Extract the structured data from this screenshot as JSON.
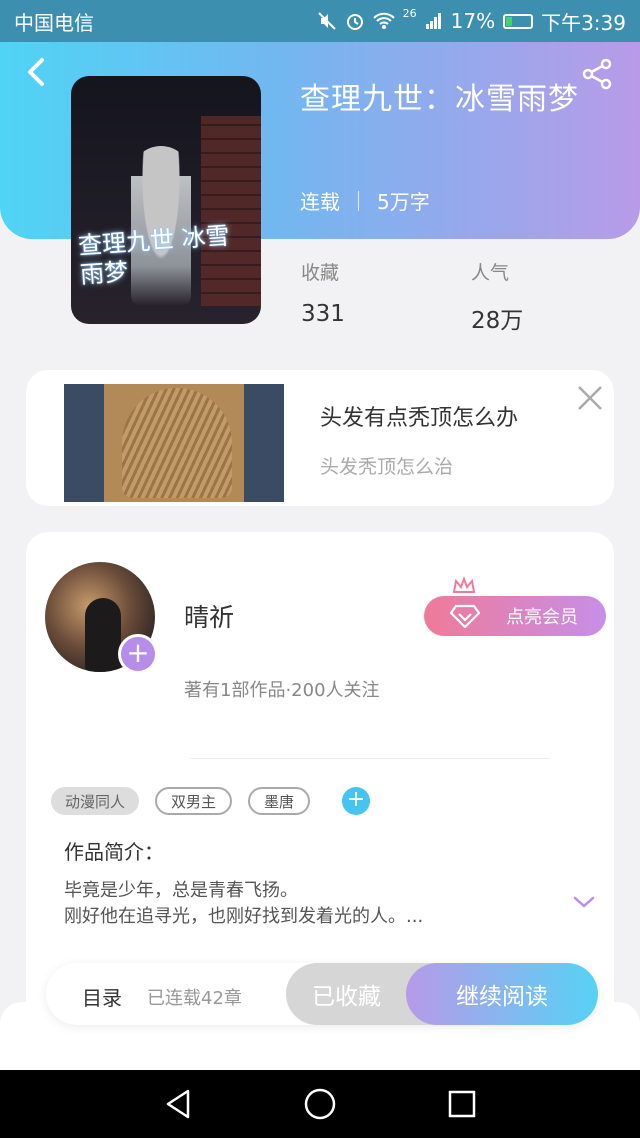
{
  "status_bar": {
    "carrier": "中国电信",
    "network": "26",
    "battery": "17%",
    "time": "下午3:39"
  },
  "book": {
    "title": "查理九世：冰雪雨梦",
    "status": "连载",
    "word_count": "5万字",
    "cover_title": "查理九世 冰雪雨梦",
    "favorites_label": "收藏",
    "favorites_value": "331",
    "popularity_label": "人气",
    "popularity_value": "28万"
  },
  "ad": {
    "title": "头发有点秃顶怎么办",
    "subtitle": "头发秃顶怎么治"
  },
  "author": {
    "name": "晴祈",
    "info": "著有1部作品·200人关注",
    "vip_label": "点亮会员"
  },
  "tags": [
    {
      "label": "动漫同人"
    },
    {
      "label": "双男主"
    },
    {
      "label": "墨唐"
    }
  ],
  "intro": {
    "label": "作品简介：",
    "line1": "毕竟是少年，总是青春飞扬。",
    "line2": "刚好他在追寻光，也刚好找到发着光的人。..."
  },
  "action_bar": {
    "toc_label": "目录",
    "toc_count": "已连载42章",
    "collected_label": "已收藏",
    "read_label": "继续阅读"
  },
  "colors": {
    "header_gradient_start": "#4fd4f5",
    "header_gradient_end": "#b89be8",
    "accent_purple": "#b68ee9",
    "accent_blue": "#45c4f0"
  }
}
